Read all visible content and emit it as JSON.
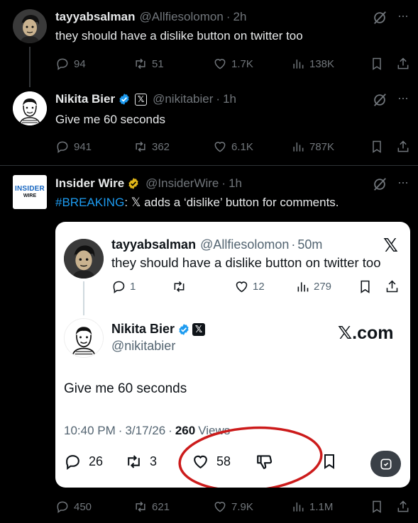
{
  "posts": [
    {
      "name": "tayyabsalman",
      "handle": "@Allfiesolomon",
      "sep": "·",
      "time": "2h",
      "text": "they should have a dislike button on twitter too",
      "replies": "94",
      "reposts": "51",
      "likes": "1.7K",
      "views": "138K"
    },
    {
      "name": "Nikita Bier",
      "handle": "@nikitabier",
      "sep": "·",
      "time": "1h",
      "text": "Give me 60 seconds",
      "replies": "941",
      "reposts": "362",
      "likes": "6.1K",
      "views": "787K"
    },
    {
      "name": "Insider Wire",
      "handle": "@InsiderWire",
      "sep": "·",
      "time": "1h",
      "hashtag": "#BREAKING",
      "text_rest": ": 𝕏 adds a ‘dislike’ button for comments.",
      "replies": "450",
      "reposts": "621",
      "likes": "7.9K",
      "views": "1.1M",
      "logo_line1": "INSIDER",
      "logo_line2": "WIRE"
    }
  ],
  "card": {
    "quoted": {
      "name": "tayyabsalman",
      "handle": "@Allfiesolomon",
      "sep": "·",
      "time": "50m",
      "text": "they should have a dislike button on twitter too",
      "replies": "1",
      "reposts": "",
      "likes": "12",
      "views": "279"
    },
    "main": {
      "name": "Nikita Bier",
      "handle": "@nikitabier",
      "text": "Give me 60 seconds",
      "time": "10:40 PM",
      "date": "3/17/26",
      "sep": "·",
      "views_count": "260",
      "views_label": "Views",
      "replies": "26",
      "reposts": "3",
      "likes": "58"
    },
    "brand": "𝕏.com",
    "x_logo": "𝕏"
  },
  "colors": {
    "background": "#000000",
    "link_blue": "#1d9bf0",
    "verified_blue": "#1d9bf0",
    "verified_gold": "#e2b719",
    "annotation_red": "#cc1b1b",
    "logo_blue": "#1565c0"
  },
  "icons": [
    "reply-icon",
    "repost-icon",
    "like-icon",
    "views-icon",
    "bookmark-icon",
    "share-icon",
    "grok-icon",
    "more-icon",
    "dislike-icon",
    "verified-icon"
  ]
}
